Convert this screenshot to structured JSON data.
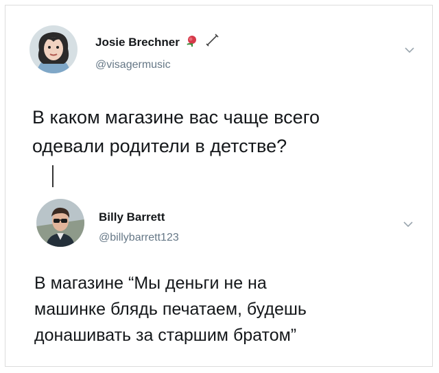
{
  "tweets": [
    {
      "name": "Josie Brechner",
      "handle": "@visagermusic",
      "text": "В каком магазине вас чаще всего\nодевали родители в детстве?",
      "badge_icons": [
        "rose-icon",
        "sword-icon"
      ]
    },
    {
      "name": "Billy Barrett",
      "handle": "@billybarrett123",
      "text": "В магазине “Мы деньги не на\nмашинке блядь печатаем, будешь\nдонашивать за старшим братом”"
    }
  ],
  "colors": {
    "text": "#14171a",
    "secondary": "#657786",
    "rose": "#d63a4a",
    "border": "#dcdcdc"
  }
}
